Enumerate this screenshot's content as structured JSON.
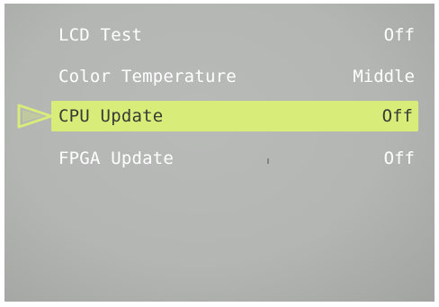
{
  "menu": {
    "items": [
      {
        "label": "LCD Test",
        "value": "Off"
      },
      {
        "label": "Color Temperature",
        "value": "Middle"
      },
      {
        "label": "CPU Update",
        "value": "Off"
      },
      {
        "label": "FPGA Update",
        "value": "Off"
      }
    ],
    "selected_index": 2
  },
  "colors": {
    "screen_background": "#b4b6b4",
    "highlight": "#d8ec7a",
    "pointer": "#d8ec7a",
    "text": "#ffffff",
    "selected_text": "#3a3a34"
  },
  "icons": {
    "pointer": "triangle-pointer-icon"
  }
}
